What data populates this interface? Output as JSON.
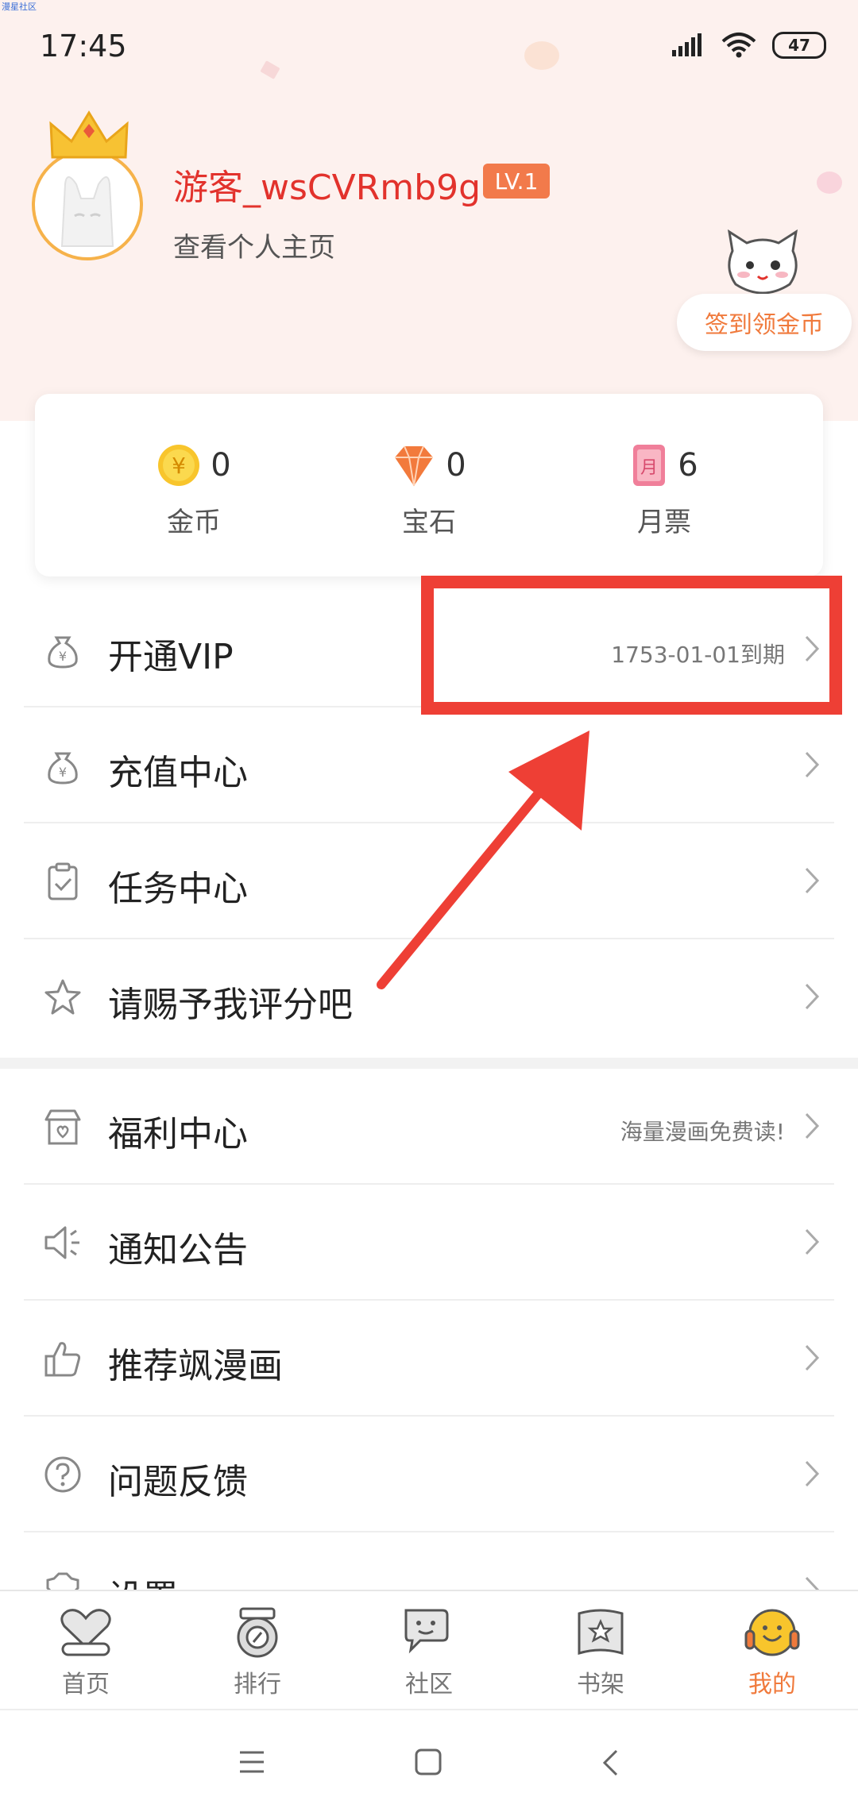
{
  "watermark": "漫星社区",
  "status_bar": {
    "time": "17:45",
    "battery": "47"
  },
  "profile": {
    "username": "游客_wsCVRmb9g",
    "level": "LV.1",
    "view_profile": "查看个人主页",
    "checkin_label": "签到领金币"
  },
  "stats": [
    {
      "icon": "gold-coin-icon",
      "value": "0",
      "label": "金币"
    },
    {
      "icon": "gem-icon",
      "value": "0",
      "label": "宝石"
    },
    {
      "icon": "monthly-ticket-icon",
      "value": "6",
      "label": "月票",
      "icon_char": "月"
    }
  ],
  "menu_group_1": [
    {
      "icon": "money-bag-icon",
      "label": "开通VIP",
      "right_text": "1753-01-01到期"
    },
    {
      "icon": "money-bag-icon",
      "label": "充值中心",
      "right_text": ""
    },
    {
      "icon": "clipboard-check-icon",
      "label": "任务中心",
      "right_text": ""
    },
    {
      "icon": "star-icon",
      "label": "请赐予我评分吧",
      "right_text": ""
    }
  ],
  "menu_group_2": [
    {
      "icon": "gift-shop-icon",
      "label": "福利中心",
      "right_text": "海量漫画免费读!"
    },
    {
      "icon": "speaker-icon",
      "label": "通知公告",
      "right_text": ""
    },
    {
      "icon": "thumbs-up-icon",
      "label": "推荐飒漫画",
      "right_text": ""
    },
    {
      "icon": "question-icon",
      "label": "问题反馈",
      "right_text": ""
    },
    {
      "icon": "settings-icon",
      "label": "设置",
      "right_text": ""
    }
  ],
  "bottom_nav": [
    {
      "icon": "heart-home-icon",
      "label": "首页",
      "active": false
    },
    {
      "icon": "ranking-icon",
      "label": "排行",
      "active": false
    },
    {
      "icon": "community-chat-icon",
      "label": "社区",
      "active": false
    },
    {
      "icon": "bookshelf-icon",
      "label": "书架",
      "active": false
    },
    {
      "icon": "mine-face-icon",
      "label": "我的",
      "active": true
    }
  ],
  "colors": {
    "accent": "#f07a3c",
    "annotation_red": "#ee3f35",
    "username_red": "#e2322c",
    "header_bg": "#fdf1ee"
  }
}
